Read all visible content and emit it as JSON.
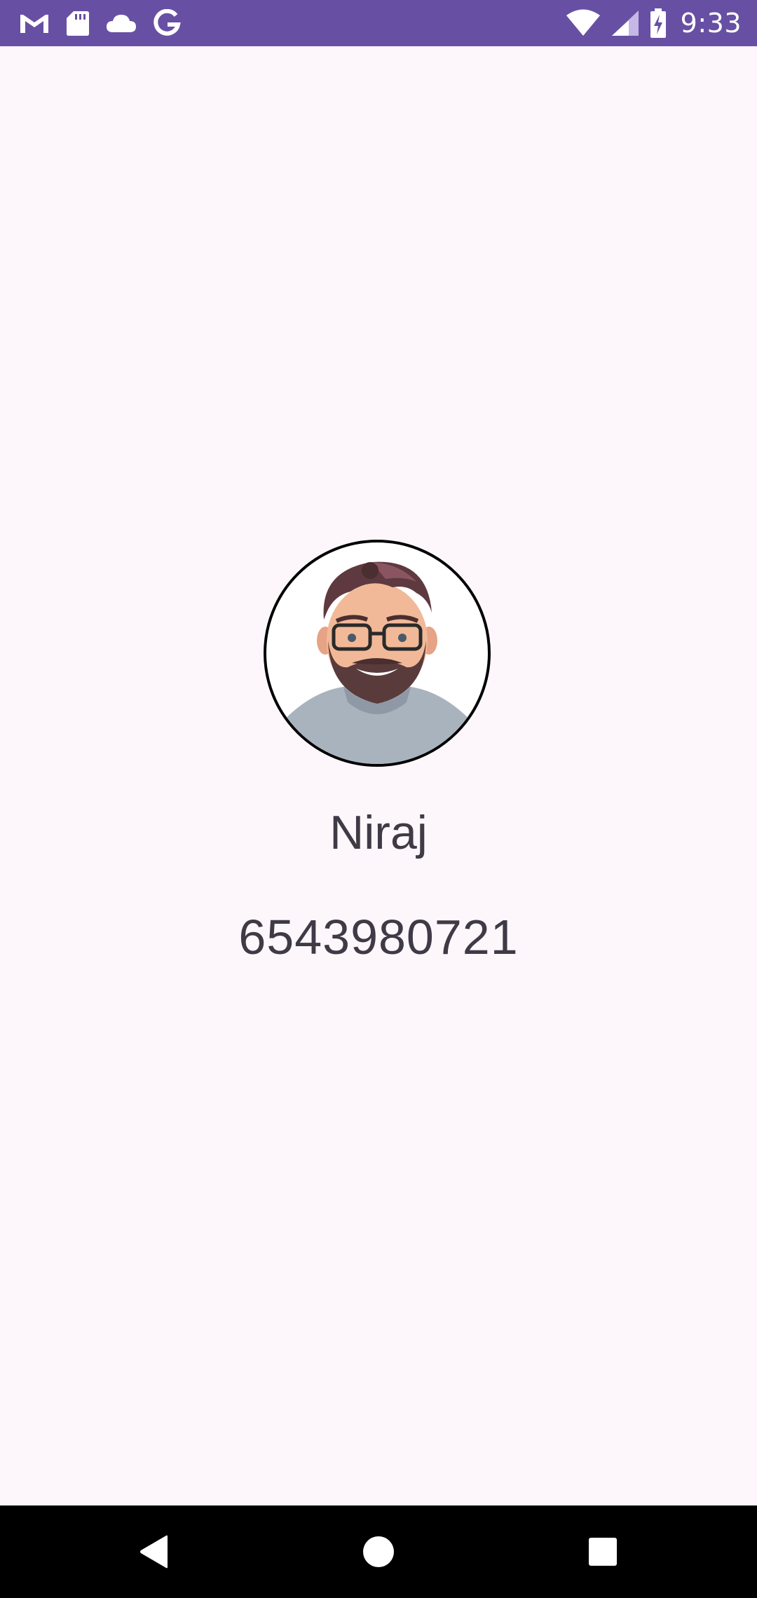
{
  "status_bar": {
    "time": "9:33",
    "background_color": "#6750a4",
    "left_icons": [
      "gmail-icon",
      "sd-card-icon",
      "cloud-icon",
      "google-icon"
    ],
    "right_icons": [
      "wifi-icon",
      "cell-signal-icon",
      "battery-charging-icon"
    ]
  },
  "profile": {
    "name": "Niraj",
    "phone": "6543980721",
    "avatar_icon": "avatar-cartoon-man-icon"
  },
  "nav_bar": {
    "buttons": [
      "back-icon",
      "home-icon",
      "recents-icon"
    ]
  }
}
